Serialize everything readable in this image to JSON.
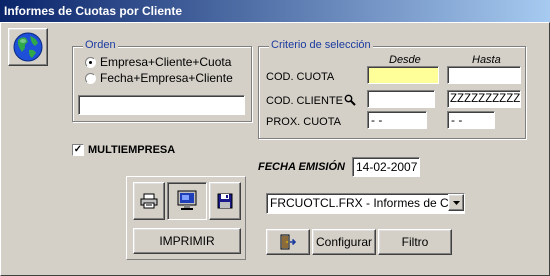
{
  "window": {
    "title": "Informes de Cuotas por Cliente"
  },
  "orden": {
    "title": "Orden",
    "options": [
      "Empresa+Cliente+Cuota",
      "Fecha+Empresa+Cliente"
    ],
    "selected": 0,
    "text_value": ""
  },
  "criterio": {
    "title": "Criterio de selección",
    "col_desde": "Desde",
    "col_hasta": "Hasta",
    "rows": [
      {
        "label": "COD. CUOTA",
        "desde": "",
        "hasta": ""
      },
      {
        "label": "COD. CLIENTE",
        "desde": "",
        "hasta": "ZZZZZZZZZZ"
      },
      {
        "label": "PROX. CUOTA",
        "desde": " -  -",
        "hasta": " -  -"
      }
    ]
  },
  "multiempresa": {
    "label": "MULTIEMPRESA",
    "checked": true
  },
  "fecha_emision": {
    "label": "FECHA EMISIÓN",
    "value": "14-02-2007"
  },
  "report_select": {
    "value": "FRCUOTCL.FRX - Informes de Cuot"
  },
  "buttons": {
    "imprimir": "IMPRIMIR",
    "configurar": "Configurar",
    "filtro": "Filtro"
  },
  "colors": {
    "face": "#d4d0c8",
    "title_start": "#0a246a",
    "title_end": "#a6caf0",
    "group_title": "#1a3aa0",
    "focused_input": "#ffff99"
  }
}
